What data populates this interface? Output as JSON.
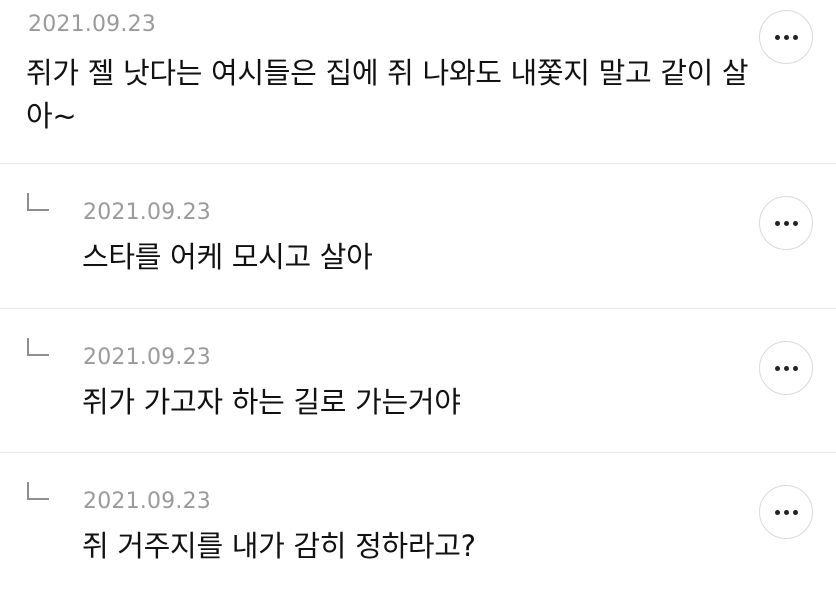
{
  "comments": [
    {
      "date": "2021.09.23",
      "text": "쥐가 젤 낫다는 여시들은 집에 쥐 나와도 내쫓지 말고 같이 살아~",
      "is_reply": false
    },
    {
      "date": "2021.09.23",
      "text": "스타를 어케 모시고 살아",
      "is_reply": true
    },
    {
      "date": "2021.09.23",
      "text": "쥐가 가고자 하는 길로 가는거야",
      "is_reply": true
    },
    {
      "date": "2021.09.23",
      "text": "쥐 거주지를 내가 감히 정하라고?",
      "is_reply": true
    }
  ],
  "icons": {
    "more": "more-icon",
    "reply": "reply-arrow-icon"
  }
}
